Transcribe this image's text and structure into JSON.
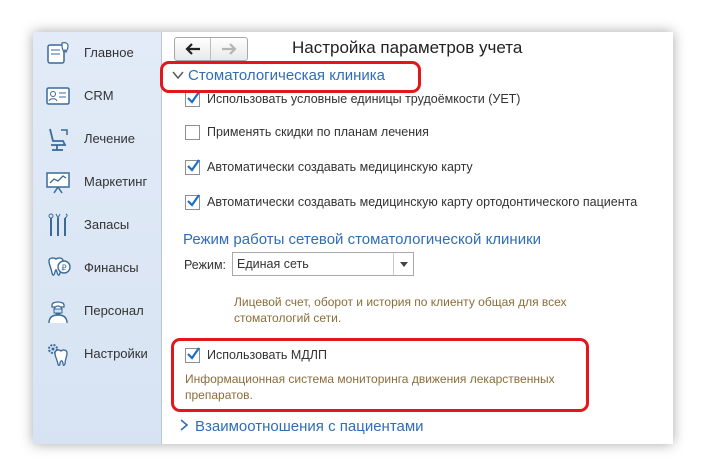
{
  "sidebar": {
    "items": [
      {
        "label": "Главное",
        "icon": "home-tooth-icon"
      },
      {
        "label": "CRM",
        "icon": "crm-card-icon"
      },
      {
        "label": "Лечение",
        "icon": "dental-chair-icon"
      },
      {
        "label": "Маркетинг",
        "icon": "presentation-board-icon"
      },
      {
        "label": "Запасы",
        "icon": "dental-tools-icon"
      },
      {
        "label": "Финансы",
        "icon": "tooth-coin-icon"
      },
      {
        "label": "Персонал",
        "icon": "doctor-icon"
      },
      {
        "label": "Настройки",
        "icon": "tooth-gear-icon"
      }
    ]
  },
  "toolbar": {
    "back_icon": "arrow-left-icon",
    "forward_icon": "arrow-right-icon"
  },
  "main": {
    "title": "Настройка параметров учета",
    "group": {
      "label": "Стоматологическая клиника",
      "options": [
        {
          "label": "Использовать условные единицы трудоёмкости (УЕТ)",
          "checked": true
        },
        {
          "label": "Применять скидки по планам лечения",
          "checked": false
        },
        {
          "label": "Автоматически создавать медицинскую карту",
          "checked": true
        },
        {
          "label": "Автоматически создавать медицинскую карту ортодонтического пациента",
          "checked": true
        }
      ]
    },
    "network": {
      "title": "Режим работы сетевой стоматологической клиники",
      "mode_label": "Режим:",
      "mode_value": "Единая сеть",
      "hint_line1": "Лицевой счет, оборот и история по клиенту общая для всех",
      "hint_line2": "стоматологий сети."
    },
    "mdlp": {
      "label": "Использовать МДЛП",
      "checked": true,
      "hint_line1": "Информационная система мониторинга движения лекарственных",
      "hint_line2": "препаратов."
    },
    "collapsed_group": {
      "label": "Взаимоотношения с пациентами"
    }
  },
  "colors": {
    "accent": "#2f6eb6",
    "highlight": "#e3161b",
    "hint": "#8a6d3b",
    "check": "#1f6fc1"
  }
}
